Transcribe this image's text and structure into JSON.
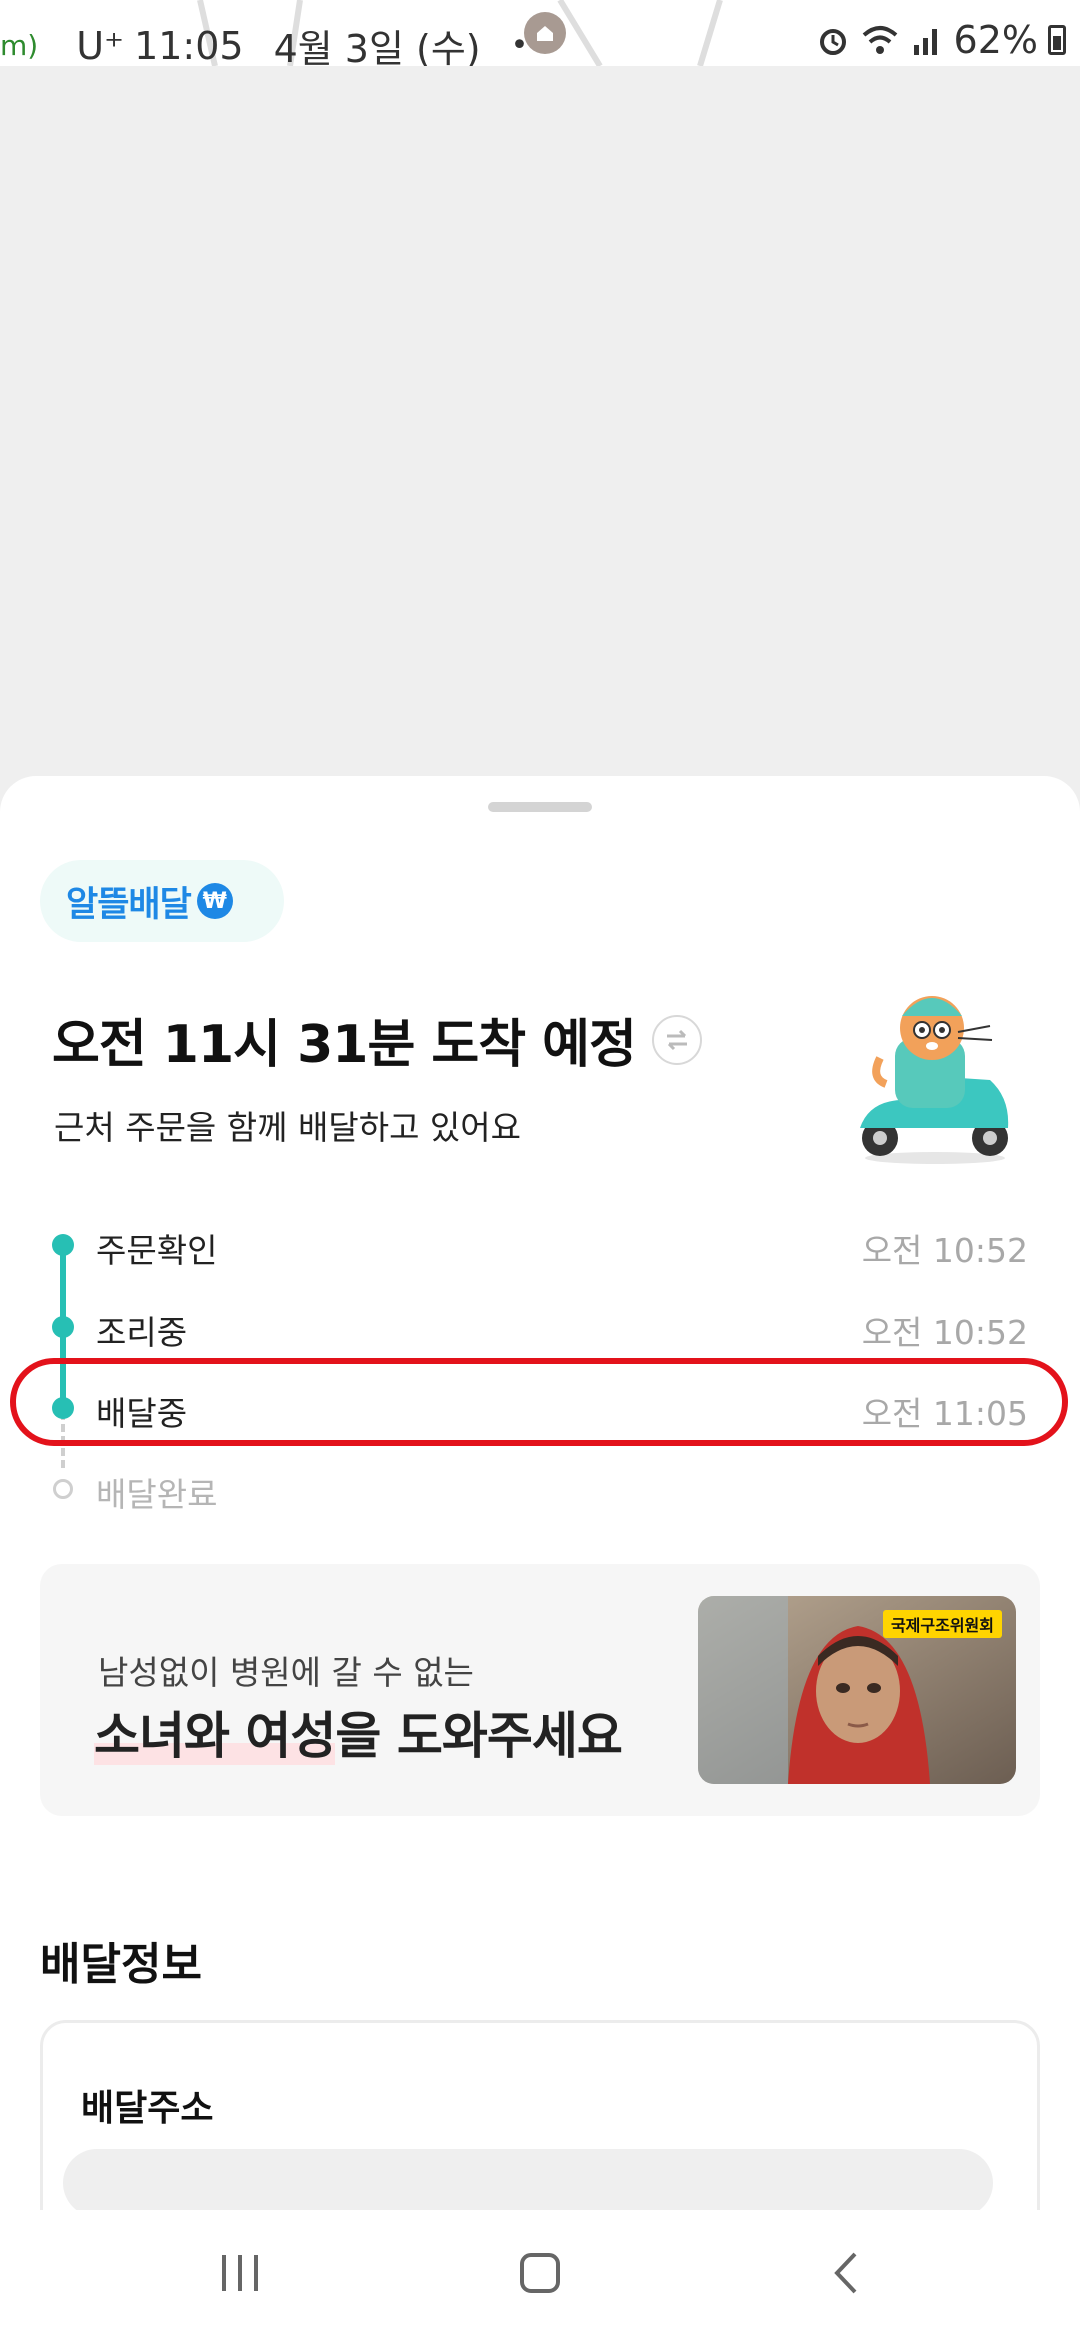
{
  "status_bar": {
    "partial_text": "m)",
    "carrier": "U⁺",
    "time": "11:05",
    "date": "4월 3일 (수)",
    "separator": "•",
    "battery": "62%"
  },
  "sheet": {
    "badge_label": "알뜰배달",
    "eta_title": "오전 11시 31분 도착 예정",
    "eta_subtitle": "근처 주문을 함께 배달하고 있어요",
    "timeline": [
      {
        "label": "주문확인",
        "time": "오전 10:52",
        "done": true
      },
      {
        "label": "조리중",
        "time": "오전 10:52",
        "done": true
      },
      {
        "label": "배달중",
        "time": "오전 11:05",
        "done": true
      },
      {
        "label": "배달완료",
        "time": "",
        "done": false
      }
    ],
    "banner": {
      "subtitle": "남성없이 병원에 갈 수 없는",
      "title_highlight": "소녀와 여성",
      "title_rest": "을 도와주세요",
      "logo_text": "국제구조위원회"
    },
    "section_title": "배달정보",
    "info_card": {
      "label": "배달주소",
      "value": ""
    }
  },
  "colors": {
    "accent_teal": "#27bfb4",
    "badge_blue": "#1e88e5",
    "highlight_red": "#e3121b"
  }
}
